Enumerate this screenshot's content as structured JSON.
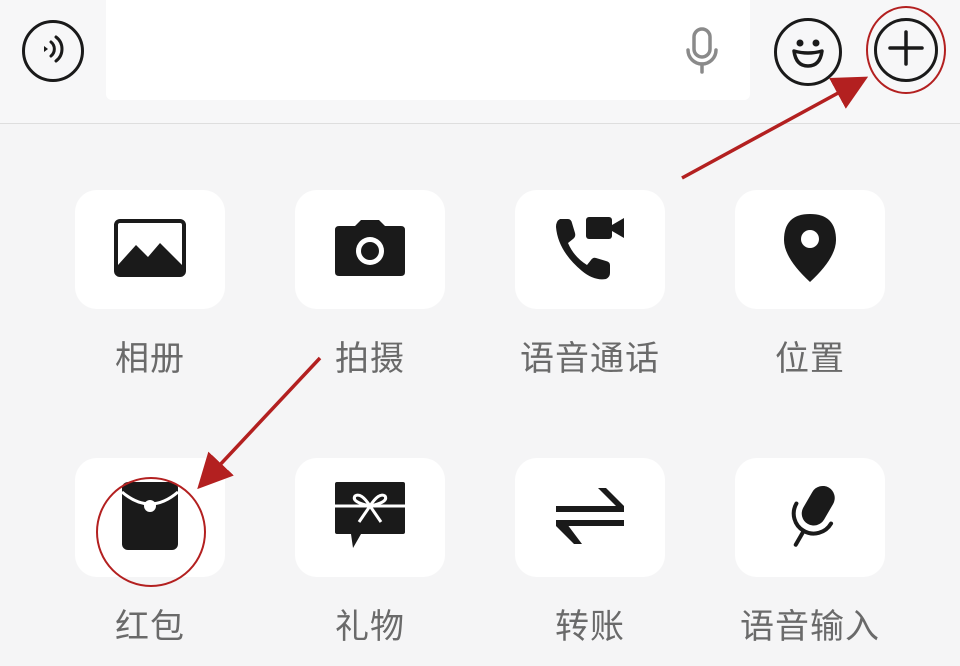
{
  "toolbar": {
    "input_value": "",
    "icons": {
      "voice": "voice-wave-icon",
      "mic": "microphone-icon",
      "emoji": "smiley-face-icon",
      "more": "plus-circle-icon"
    }
  },
  "panel": {
    "items": [
      {
        "label": "相册",
        "icon": "image-icon"
      },
      {
        "label": "拍摄",
        "icon": "camera-icon"
      },
      {
        "label": "语音通话",
        "icon": "phone-video-icon"
      },
      {
        "label": "位置",
        "icon": "location-pin-icon"
      },
      {
        "label": "红包",
        "icon": "red-envelope-icon"
      },
      {
        "label": "礼物",
        "icon": "gift-icon"
      },
      {
        "label": "转账",
        "icon": "transfer-arrows-icon"
      },
      {
        "label": "语音输入",
        "icon": "voice-input-mic-icon"
      }
    ]
  },
  "colors": {
    "background": "#f5f5f6",
    "tile": "#ffffff",
    "icon": "#1a1a1a",
    "label": "#6a6a6a",
    "annotation": "#b32020"
  }
}
